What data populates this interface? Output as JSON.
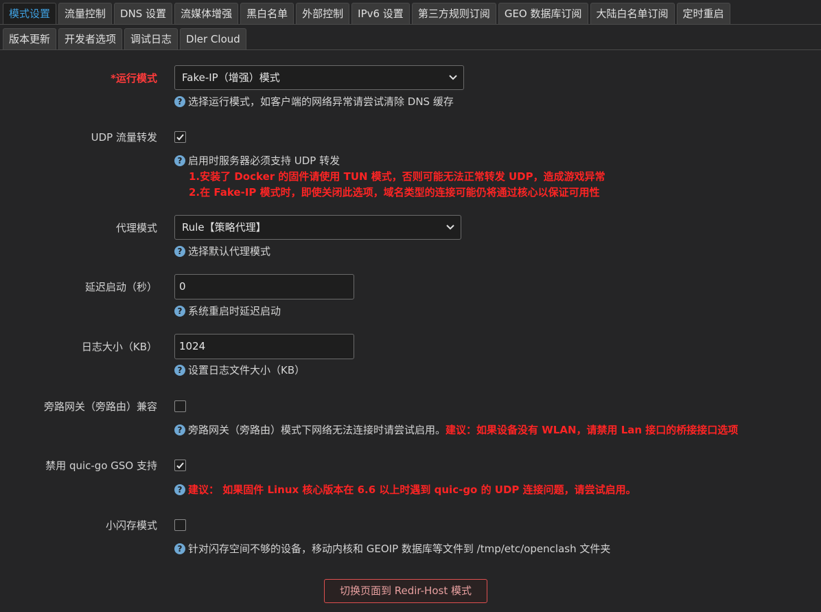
{
  "tabs_row1": [
    "模式设置",
    "流量控制",
    "DNS 设置",
    "流媒体增强",
    "黑白名单",
    "外部控制",
    "IPv6 设置",
    "第三方规则订阅",
    "GEO 数据库订阅",
    "大陆白名单订阅",
    "定时重启"
  ],
  "tabs_row2": [
    "版本更新",
    "开发者选项",
    "调试日志",
    "Dler Cloud"
  ],
  "active_tab": "模式设置",
  "run_mode": {
    "star": "*",
    "label": "运行模式",
    "value": "Fake-IP（增强）模式",
    "help": "选择运行模式，如客户端的网络异常请尝试清除 DNS 缓存"
  },
  "udp": {
    "label": "UDP 流量转发",
    "checked": true,
    "help": "启用时服务器必须支持 UDP 转发",
    "warn1": "1.安装了 Docker 的固件请使用 TUN 模式，否则可能无法正常转发 UDP，造成游戏异常",
    "warn2": "2.在 Fake-IP 模式时，即使关闭此选项，域名类型的连接可能仍将通过核心以保证可用性"
  },
  "proxy_mode": {
    "label": "代理模式",
    "value": "Rule【策略代理】",
    "help": "选择默认代理模式"
  },
  "delay_start": {
    "label": "延迟启动（秒）",
    "value": "0",
    "help": "系统重启时延迟启动"
  },
  "log_size": {
    "label": "日志大小（KB）",
    "value": "1024",
    "help": "设置日志文件大小（KB）"
  },
  "bypass_gateway": {
    "label": "旁路网关（旁路由）兼容",
    "checked": false,
    "help": "旁路网关（旁路由）模式下网络无法连接时请尝试启用。",
    "warn": "建议：如果设备没有 WLAN，请禁用 Lan 接口的桥接接口选项"
  },
  "quic_gso": {
    "label": "禁用 quic-go GSO 支持",
    "checked": true,
    "warn": "建议： 如果固件 Linux 核心版本在 6.6 以上时遇到 quic-go 的 UDP 连接问题，请尝试启用。"
  },
  "small_flash": {
    "label": "小闪存模式",
    "checked": false,
    "help": "针对闪存空间不够的设备，移动内核和 GEOIP 数据库等文件到 /tmp/etc/openclash 文件夹"
  },
  "switch_button": "切换页面到 Redir-Host 模式",
  "help_icon": "?"
}
